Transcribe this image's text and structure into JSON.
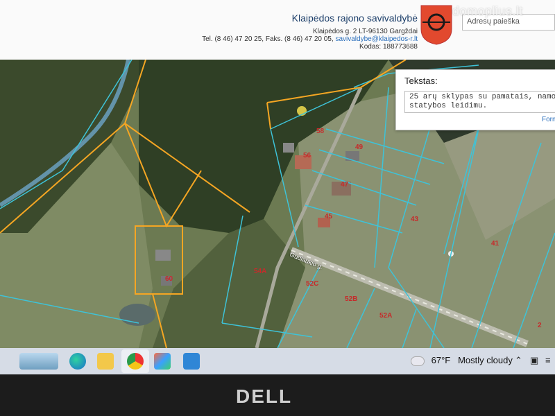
{
  "header": {
    "title": "Klaipėdos rajono savivaldybė",
    "address": "Klaipėdos g. 2 LT-96130 Gargždai",
    "contact_prefix": "Tel. (8 46) 47 20 25, Faks. (8 46) 47 20 05,",
    "email": "savivaldybe@klaipedos-r.lt",
    "code": "Kodas: 188773688",
    "search_placeholder": "Adresų paieška",
    "watermark": "domoplius.lt"
  },
  "text_panel": {
    "title": "Tekstas:",
    "line1": "25 arų sklypas su pamatais, namo",
    "line2": "statybos leidimu.",
    "link": "Form"
  },
  "map_labels": {
    "l58": "58",
    "l56": "56",
    "l49": "49",
    "l47": "47",
    "l45": "45",
    "l43": "43",
    "l41": "41",
    "l60": "60",
    "l54a": "54A",
    "l52c": "52C",
    "l52b": "52B",
    "l52a": "52A",
    "l2": "2",
    "street": "Gudlaukio g."
  },
  "taskbar": {
    "temp": "67°F",
    "weather": "Mostly cloudy"
  },
  "device": {
    "brand": "DELL"
  },
  "colors": {
    "parcel_highlight": "#f5a623",
    "parcel_border": "#3ec3d8",
    "label_red": "#c62b2b",
    "crest_red": "#e2492e"
  }
}
